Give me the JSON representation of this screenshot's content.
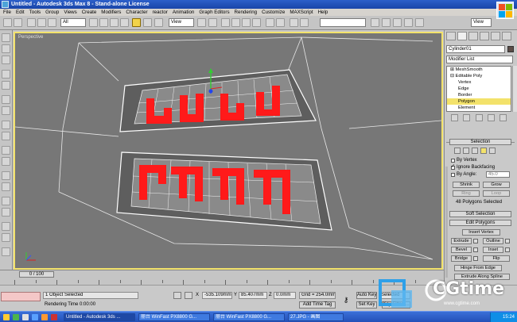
{
  "window": {
    "title": "Untitled - Autodesk 3ds Max 8 - Stand-alone License"
  },
  "menu": [
    "File",
    "Edit",
    "Tools",
    "Group",
    "Views",
    "Create",
    "Modifiers",
    "Character",
    "reactor",
    "Animation",
    "Graph Editors",
    "Rendering",
    "Customize",
    "MAXScript",
    "Help"
  ],
  "toolbar": {
    "selection_filter": "All",
    "ref_coord": "View",
    "named_sel": "",
    "view_right": "View"
  },
  "viewport": {
    "label": "Perspective"
  },
  "command_panel": {
    "object_name": "Cylinder01",
    "modifier_list": "Modifier List",
    "stack": [
      "MeshSmooth",
      "Editable Poly",
      "Vertex",
      "Edge",
      "Border",
      "Polygon",
      "Element"
    ],
    "selection": {
      "title": "Selection",
      "by_vertex": "By Vertex",
      "ignore_backfacing": "Ignore Backfacing",
      "by_angle": "By Angle:",
      "angle_value": "45.0",
      "shrink": "Shrink",
      "grow": "Grow",
      "ring": "Ring",
      "loop": "Loop",
      "status": "48 Polygons Selected"
    },
    "soft_selection": "Soft Selection",
    "edit_polygons": {
      "title": "Edit Polygons",
      "insert_vertex": "Insert Vertex",
      "extrude": "Extrude",
      "outline": "Outline",
      "bevel": "Bevel",
      "inset": "Inset",
      "bridge": "Bridge",
      "flip": "Flip",
      "hinge": "Hinge From Edge",
      "extrude_spline": "Extrude Along Spline"
    }
  },
  "timeline": {
    "frame": "0 / 100",
    "ticks": [
      "0",
      "10",
      "20",
      "30",
      "40",
      "50",
      "60",
      "70",
      "80",
      "90",
      "100"
    ]
  },
  "status": {
    "objects": "1 Object Selected",
    "render_time": "Rendering Time  0:00:00",
    "x_label": "X",
    "x_value": "-535.109mm",
    "y_label": "Y",
    "y_value": "85.407mm",
    "z_label": "Z",
    "z_value": "0.0mm",
    "grid": "Grid = 254.0mm",
    "add_time_tag": "Add Time Tag",
    "auto_key": "Auto Key",
    "set_key": "Set Key",
    "selected": "Selected",
    "key_filters": "Key Filters..."
  },
  "watermark": {
    "brand": "CGtime",
    "sub": "www.cgtime.com"
  },
  "taskbar": {
    "items": [
      "Untitled - Autodesk 3ds ...",
      "丽台 WinFast PX8800 G...",
      "丽台 WinFast PX8800 G...",
      "27.JPG - 画图"
    ],
    "clock": "15:24"
  },
  "colors": {
    "selection_red": "#ff1a1a",
    "active_yellow": "#f3e26b",
    "title_blue": "#1945a8"
  }
}
